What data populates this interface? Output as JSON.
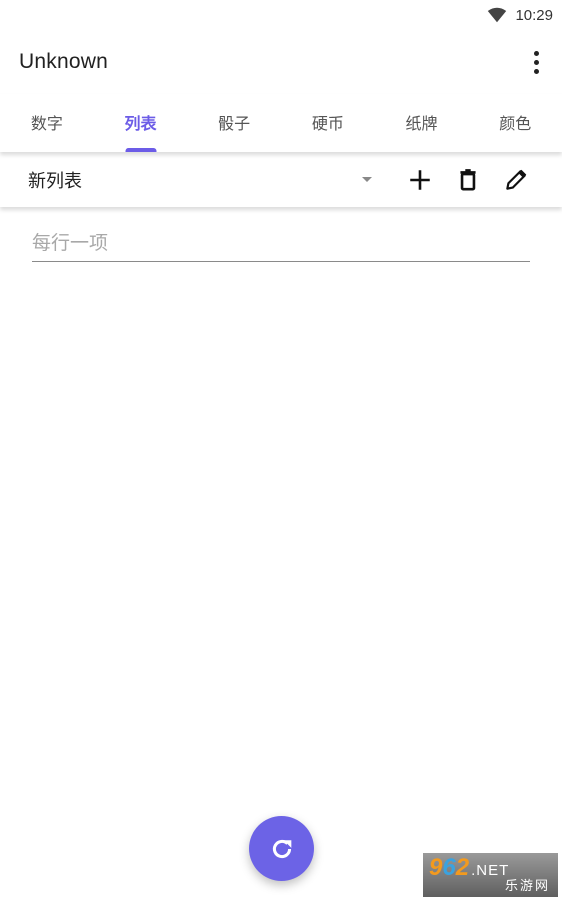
{
  "status_bar": {
    "wifi_icon": "wifi-icon",
    "time": "10:29"
  },
  "app_bar": {
    "title": "Unknown",
    "overflow_icon": "more-vert-icon"
  },
  "tabs": [
    {
      "label": "数字",
      "active": false
    },
    {
      "label": "列表",
      "active": true
    },
    {
      "label": "骰子",
      "active": false
    },
    {
      "label": "硬币",
      "active": false
    },
    {
      "label": "纸牌",
      "active": false
    },
    {
      "label": "颜色",
      "active": false
    }
  ],
  "list_toolbar": {
    "selected_list": "新列表",
    "dropdown_icon": "arrow-drop-down-icon",
    "add_icon": "plus-icon",
    "delete_icon": "trash-icon",
    "edit_icon": "pencil-icon"
  },
  "entry": {
    "value": "",
    "placeholder": "每行一项"
  },
  "fab": {
    "icon": "refresh-icon"
  },
  "colors": {
    "accent": "#6c5ce7",
    "fab": "#6c63e6"
  },
  "watermark": {
    "num_9": "9",
    "num_6": "6",
    "num_2": "2",
    "net": ".NET",
    "sub": "乐游网"
  }
}
